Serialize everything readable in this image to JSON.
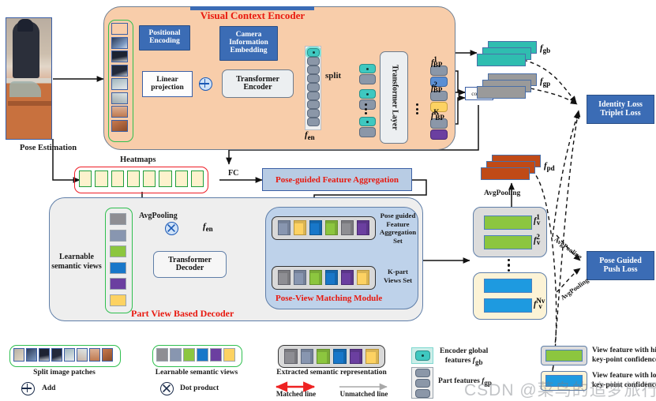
{
  "figure": {
    "type": "architecture-diagram",
    "topic": "Pose-guided transformer person re-identification network"
  },
  "modules": {
    "visual_context_encoder": {
      "title": "Visual Context Encoder",
      "blocks": {
        "positional_encoding": "Positional\nEncoding",
        "positional_encoding_line1": "Positional",
        "positional_encoding_line2": "Encoding",
        "camera_line1": "Camera",
        "camera_line2": "Information",
        "camera_line3": "Embedding",
        "linear_line1": "Linear",
        "linear_line2": "projection",
        "transformer_line1": "Transformer",
        "transformer_line2": "Encoder",
        "transformer_layer": "Transformer Layer",
        "split": "split",
        "concat": "concat",
        "f_en": "f",
        "f_en_sub": "en"
      },
      "part_feature_labels": [
        {
          "base": "f",
          "sub": "BP",
          "sup": "1"
        },
        {
          "base": "f",
          "sub": "BP",
          "sup": "2"
        },
        {
          "base": "f",
          "sub": "BP",
          "sup": "K"
        }
      ]
    },
    "pose_estimation": {
      "label": "Pose Estimation",
      "heatmaps_label": "Heatmaps",
      "heatmap_count": 8,
      "fc_label": "FC"
    },
    "pose_guided_feature_aggregation": {
      "title": "Pose-guided Feature Aggregation"
    },
    "part_view_based_decoder": {
      "title": "Part View Based Decoder",
      "learnable_line1": "Learnable",
      "learnable_line2": "semantic views",
      "avgpooling": "AvgPooling",
      "f_en": "f",
      "f_en_sub": "en",
      "transformer_line1": "Transformer",
      "transformer_line2": "Decoder",
      "semantic_view_colors": [
        "#8e8e93",
        "#8896b0",
        "#8cc63f",
        "#1877c9",
        "#6b3fa0",
        "#fdd262"
      ]
    },
    "pose_view_matching_module": {
      "title": "Pose-View Matching Module",
      "set_a_line1": "Pose guided",
      "set_a_line2": "Feature",
      "set_a_line3": "Aggregation",
      "set_a_line4": "Set",
      "set_b_line1": "K-part",
      "set_b_line2": "Views Set",
      "set_a_cubes": [
        "#8896b0",
        "#fdd262",
        "#1877c9",
        "#8cc63f",
        "#8e8e93",
        "#6b3fa0"
      ],
      "set_b_cubes": [
        "#8e8e93",
        "#8896b0",
        "#8cc63f",
        "#1877c9",
        "#6b3fa0",
        "#fdd262"
      ]
    }
  },
  "outputs": {
    "global_feature": {
      "base": "f",
      "sub": "gb",
      "color": "#2fbdb0"
    },
    "part_feature": {
      "base": "f",
      "sub": "gp",
      "color": "#9a9a9a"
    },
    "pose_feature": {
      "base": "f",
      "sub": "pd",
      "color": "#c04a17"
    },
    "avgpooling": "AvgPooling",
    "view_features": [
      {
        "base": "f",
        "sub": "v",
        "sup": "1",
        "color": "#8cc63f"
      },
      {
        "base": "f",
        "sub": "v",
        "sup": "2",
        "color": "#8cc63f"
      },
      {
        "base": "f",
        "sub": "v",
        "sup": "Nv",
        "color": "#1e9ae0"
      }
    ]
  },
  "losses": {
    "identity": {
      "line1": "Identity Loss",
      "line2": "Triplet Loss"
    },
    "push": {
      "line1": "Pose Guided",
      "line2": "Push Loss"
    },
    "avgpooling_label_1": "AvgPooling",
    "avgpooling_label_2": "AvgPooling"
  },
  "legend": {
    "items": [
      {
        "id": "split-image-patches",
        "label": "Split image patches"
      },
      {
        "id": "add",
        "label": "Add"
      },
      {
        "id": "learnable-semantic-views",
        "label": "Learnable semantic views"
      },
      {
        "id": "dot-product",
        "label": "Dot product"
      },
      {
        "id": "extracted-semantic-representation",
        "label": "Extracted semantic representation"
      },
      {
        "id": "matched-line",
        "label": "Matched line"
      },
      {
        "id": "unmatched-line",
        "label": "Unmatched line"
      },
      {
        "id": "encoder-global-features",
        "label_line1": "Encoder global",
        "label_line2": "features",
        "math_base": "f",
        "math_sub": "gb"
      },
      {
        "id": "part-features",
        "label": "Part features",
        "math_base": "f",
        "math_sub": "gp"
      },
      {
        "id": "view-feature-high",
        "label_line1": "View feature with high",
        "label_line2": "key-point confidence"
      },
      {
        "id": "view-feature-low",
        "label_line1": "View feature with low",
        "label_line2": "key-point confidence"
      }
    ],
    "semantic_view_colors": [
      "#8e8e93",
      "#8896b0",
      "#8cc63f",
      "#1877c9",
      "#6b3fa0",
      "#fdd262"
    ],
    "cube_colors": [
      "#8e8e93",
      "#8896b0",
      "#8cc63f",
      "#1877c9",
      "#6b3fa0",
      "#fdd262"
    ],
    "matched_color": "#ee2222",
    "unmatched_color": "#9a9a9a"
  },
  "watermark": {
    "text": "CSDN @菜鸟的追梦旅行"
  },
  "colors": {
    "encoder_panel": "#f8cdaa",
    "loss_box": "#3b6cb5",
    "red_title": "#e8190f",
    "green_frame": "#2fbf4f",
    "red_frame": "#ee1c25"
  }
}
